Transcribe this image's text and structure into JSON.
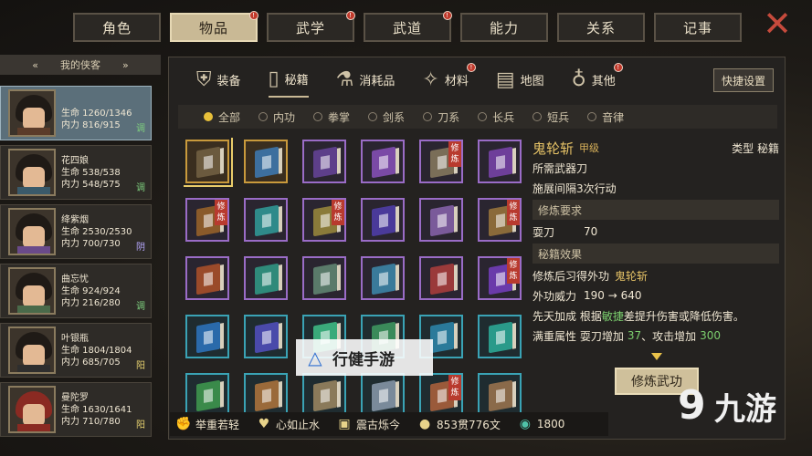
{
  "top_tabs": [
    {
      "label": "角色",
      "badge": false
    },
    {
      "label": "物品",
      "badge": true,
      "active": true
    },
    {
      "label": "武学",
      "badge": true
    },
    {
      "label": "武道",
      "badge": true
    },
    {
      "label": "能力",
      "badge": false
    },
    {
      "label": "关系",
      "badge": false
    },
    {
      "label": "记事",
      "badge": false
    }
  ],
  "badge_mark": "!",
  "close_icon": "✕",
  "heroes_header": "我的侠客",
  "heroes": [
    {
      "name": "",
      "hp": "生命 1260/1346",
      "mp": "内力 816/915",
      "tag": "调",
      "selected": true
    },
    {
      "name": "花四娘",
      "hp": "生命 538/538",
      "mp": "内力 548/575",
      "tag": "调"
    },
    {
      "name": "绛紫烟",
      "hp": "生命 2530/2530",
      "mp": "内力 700/730",
      "tag": "阴"
    },
    {
      "name": "曲忘忧",
      "hp": "生命 924/924",
      "mp": "内力 216/280",
      "tag": "调"
    },
    {
      "name": "叶银瓶",
      "hp": "生命 1804/1804",
      "mp": "内力 685/705",
      "tag": "阳"
    },
    {
      "name": "曼陀罗",
      "hp": "生命 1630/1641",
      "mp": "内力 710/780",
      "tag": "阳"
    }
  ],
  "sub_tabs": [
    {
      "label": "装备",
      "icon": "armor-icon",
      "glyph": "⛨"
    },
    {
      "label": "秘籍",
      "icon": "scroll-icon",
      "glyph": "▯",
      "active": true
    },
    {
      "label": "消耗品",
      "icon": "potion-icon",
      "glyph": "⚗"
    },
    {
      "label": "材料",
      "icon": "material-icon",
      "glyph": "✧",
      "badge": true
    },
    {
      "label": "地图",
      "icon": "map-icon",
      "glyph": "▤"
    },
    {
      "label": "其他",
      "icon": "lantern-icon",
      "glyph": "♁",
      "badge": true
    }
  ],
  "quick_settings": "快捷设置",
  "filters": [
    "全部",
    "内功",
    "拳掌",
    "剑系",
    "刀系",
    "长兵",
    "短兵",
    "音律"
  ],
  "practice_mark": "修炼",
  "detail": {
    "title": "鬼轮斩",
    "grade": "甲级",
    "type_label": "类型 秘籍",
    "weapon": "所需武器刀",
    "interval": "施展间隔3次行动",
    "req_header": "修炼要求",
    "req_skill": "耍刀",
    "req_value": "70",
    "effect_header": "秘籍效果",
    "effect_prefix": "修炼后习得外功",
    "effect_skill": "鬼轮斩",
    "power_label": "外功威力",
    "power_value": "190 → 640",
    "innate_prefix": "先天加成 根据",
    "innate_attr": "敏捷",
    "innate_suffix": "差提升伤害或降低伤害。",
    "full_prefix": "满重属性 耍刀增加",
    "full_v1": "37",
    "full_mid": "、攻击增加",
    "full_v2": "300"
  },
  "practice_button": "修炼武功",
  "status": [
    {
      "icon": "muscle-icon",
      "glyph": "✊",
      "text": "举重若轻"
    },
    {
      "icon": "heart-icon",
      "glyph": "♥",
      "text": "心如止水"
    },
    {
      "icon": "forge-icon",
      "glyph": "▣",
      "text": "震古烁今"
    },
    {
      "icon": "coin-icon",
      "glyph": "●",
      "text": "853贯776文"
    },
    {
      "icon": "jade-icon",
      "glyph": "◉",
      "text": "1800"
    }
  ],
  "watermark_left": "行健手游",
  "watermark_right": "九游",
  "colors": {
    "accent": "#e5c266",
    "purple": "#9a6cc7",
    "gold": "#c99a3c",
    "teal": "#3aa3b5",
    "badge": "#c0392b"
  }
}
